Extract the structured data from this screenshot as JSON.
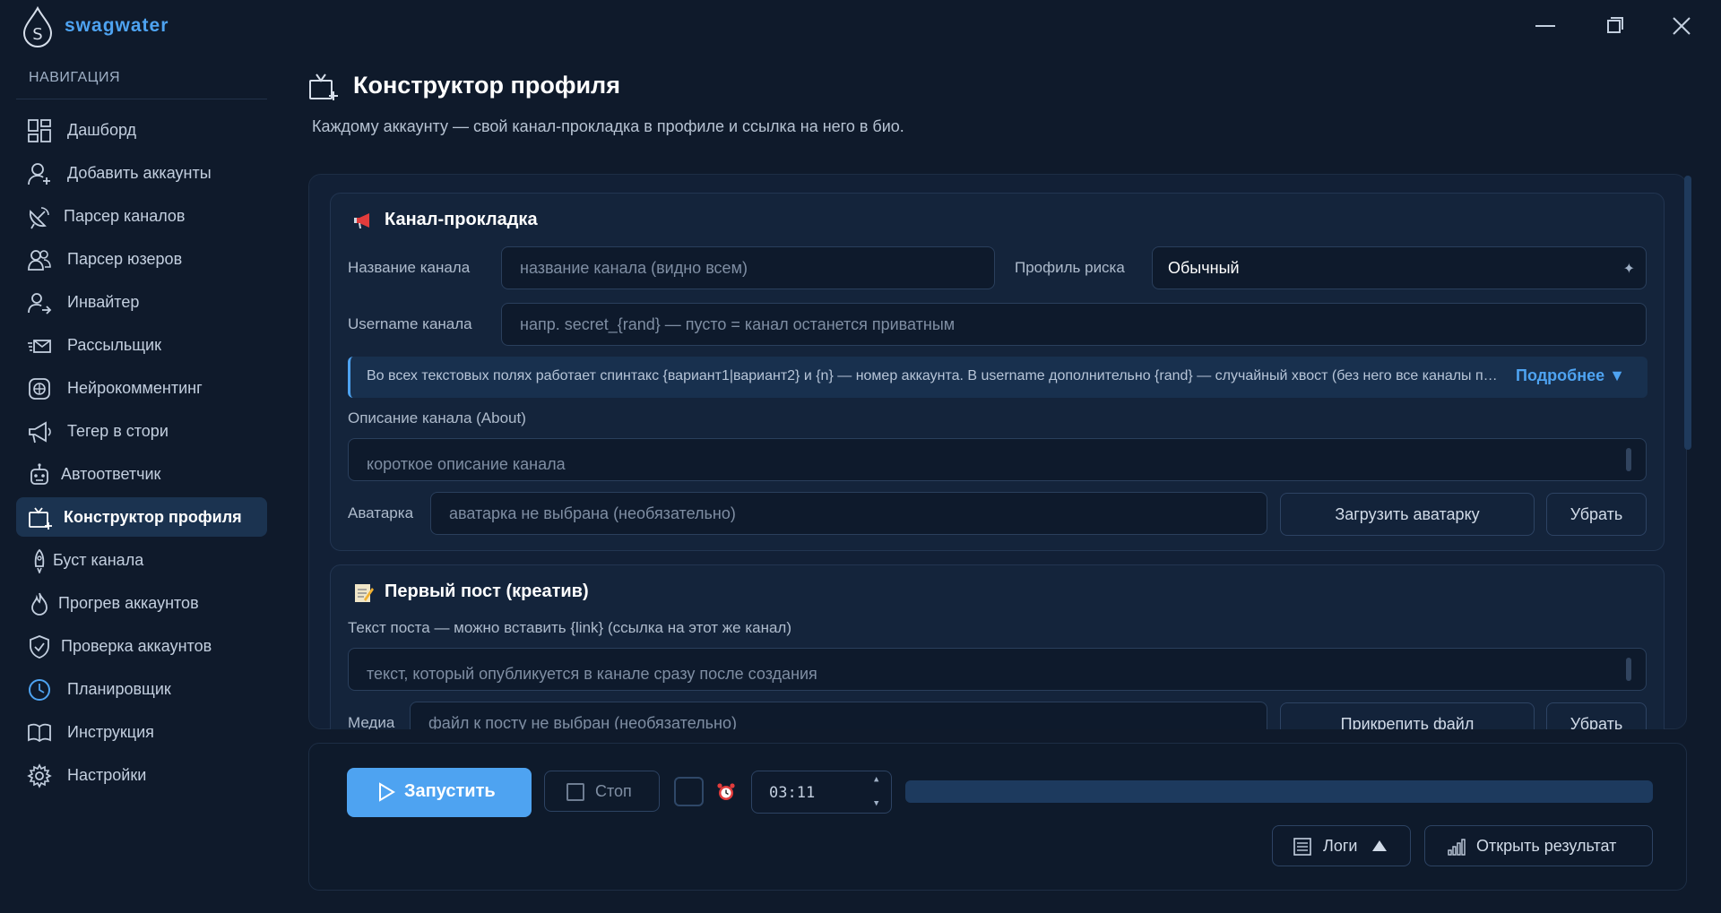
{
  "app": {
    "brand": "swagwater"
  },
  "sidebar": {
    "title": "НАВИГАЦИЯ",
    "items": [
      {
        "label": "Дашборд",
        "icon": "dashboard-icon"
      },
      {
        "label": "Добавить аккаунты",
        "icon": "add-user-icon"
      },
      {
        "label": "Парсер каналов",
        "icon": "satellite-icon"
      },
      {
        "label": "Парсер юзеров",
        "icon": "users-icon"
      },
      {
        "label": "Инвайтер",
        "icon": "invite-user-icon"
      },
      {
        "label": "Рассыльщик",
        "icon": "send-mail-icon"
      },
      {
        "label": "Нейрокомментинг",
        "icon": "brain-icon"
      },
      {
        "label": "Тегер в стори",
        "icon": "megaphone-icon"
      },
      {
        "label": "Автоответчик",
        "icon": "robot-icon"
      },
      {
        "label": "Конструктор профиля",
        "icon": "tv-add-icon",
        "active": true
      },
      {
        "label": "Буст канала",
        "icon": "rocket-icon"
      },
      {
        "label": "Прогрев аккаунтов",
        "icon": "flame-icon"
      },
      {
        "label": "Проверка аккаунтов",
        "icon": "shield-check-icon"
      },
      {
        "label": "Планировщик",
        "icon": "clock-icon"
      },
      {
        "label": "Инструкция",
        "icon": "book-icon"
      },
      {
        "label": "Настройки",
        "icon": "gear-icon"
      }
    ]
  },
  "page": {
    "title": "Конструктор профиля",
    "subtitle": "Каждому аккаунту — свой канал-прокладка в профиле и ссылка на него в био."
  },
  "channel_card": {
    "title": "Канал-прокладка",
    "name_label": "Название канала",
    "name_placeholder": "название канала (видно всем)",
    "risk_label": "Профиль риска",
    "risk_value": "Обычный",
    "username_label": "Username канала",
    "username_placeholder": "напр. secret_{rand}  —  пусто = канал останется приватным",
    "info_text": "Во всех текстовых полях работает спинтакс {вариант1|вариант2} и {n} — номер аккаунта. В username дополнительно {rand} — случайный хвост (без него все каналы получат одинаковый username)",
    "info_more": "Подробнее ▼",
    "about_label": "Описание канала (About)",
    "about_placeholder": "короткое описание канала",
    "avatar_label": "Аватарка",
    "avatar_placeholder": "аватарка не выбрана (необязательно)",
    "avatar_upload": "Загрузить аватарку",
    "avatar_remove": "Убрать"
  },
  "post_card": {
    "title": "Первый пост (креатив)",
    "text_label": "Текст поста — можно вставить {link} (ссылка на этот же канал)",
    "text_placeholder": "текст, который опубликуется в канале сразу после создания",
    "media_label": "Медиа",
    "media_placeholder": "файл к посту не выбран (необязательно)",
    "media_attach": "Прикрепить файл",
    "media_remove": "Убрать"
  },
  "controls": {
    "run": "Запустить",
    "stop": "Стоп",
    "time": "03:11",
    "progress": 0,
    "logs": "Логи",
    "open_result": "Открыть результат"
  }
}
